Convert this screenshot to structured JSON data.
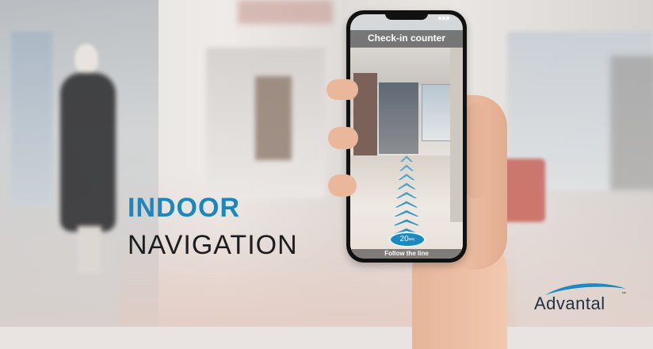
{
  "headline": {
    "line1": "INDOOR",
    "line2": "NAVIGATION"
  },
  "phone": {
    "title": "Check-in counter",
    "timer_value": "20",
    "timer_unit": "sec",
    "footer": "Follow the line",
    "arrow_color": "#1b8ac2",
    "arrow_count": 9
  },
  "logo": {
    "brand": "Advantal",
    "trademark": "™",
    "brand_color": "#1f3142",
    "swoosh_color": "#1b8ac2"
  },
  "colors": {
    "accent": "#1a87bf",
    "headline_dark": "#1d1d1f"
  }
}
